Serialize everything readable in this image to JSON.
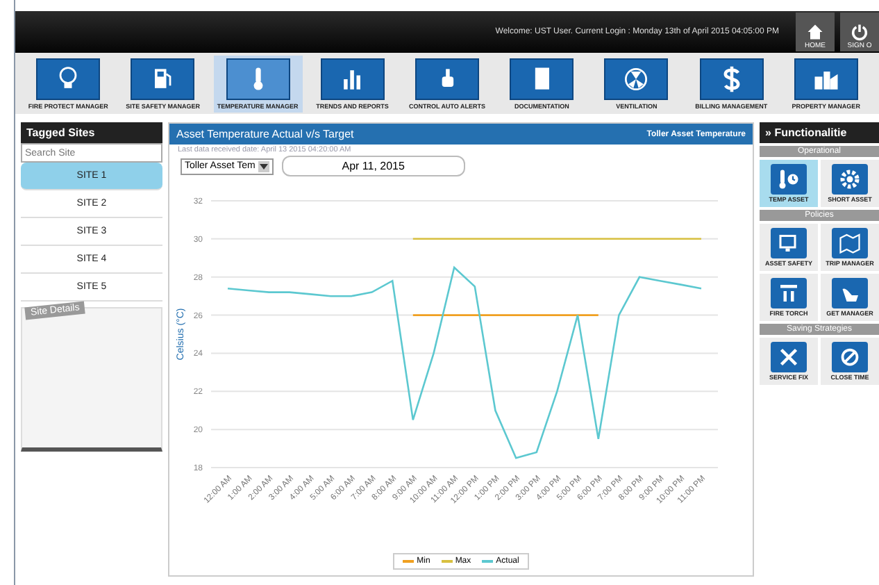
{
  "header": {
    "welcome": "Welcome: UST User. Current Login : Monday 13th of April 2015 04:05:00 PM",
    "buttons": [
      {
        "label": "HOME"
      },
      {
        "label": "SIGN O"
      }
    ]
  },
  "nav": [
    {
      "label": "FIRE PROTECT MANAGER",
      "selected": false
    },
    {
      "label": "SITE SAFETY MANAGER",
      "selected": false
    },
    {
      "label": "TEMPERATURE MANAGER",
      "selected": true
    },
    {
      "label": "TRENDS AND REPORTS",
      "selected": false
    },
    {
      "label": "CONTROL AUTO ALERTS",
      "selected": false
    },
    {
      "label": "DOCUMENTATION",
      "selected": false
    },
    {
      "label": "VENTILATION",
      "selected": false
    },
    {
      "label": "BILLING MANAGEMENT",
      "selected": false
    },
    {
      "label": "PROPERTY MANAGER",
      "selected": false
    }
  ],
  "sidebar": {
    "title": "Tagged Sites",
    "search": {
      "placeholder": "Search Site"
    },
    "sites": [
      {
        "label": "SITE 1",
        "selected": true
      },
      {
        "label": "SITE 2",
        "selected": false
      },
      {
        "label": "SITE 3",
        "selected": false
      },
      {
        "label": "SITE 4",
        "selected": false
      },
      {
        "label": "SITE 5",
        "selected": false
      }
    ],
    "details_tab": "Site Details"
  },
  "panel": {
    "title": "Asset Temperature Actual v/s Target",
    "subtitle_right": "Toller Asset Temperature",
    "last_data": "Last data received date: April 13 2015 04:20:00 AM",
    "asset_select": "Toller Asset Tem",
    "date": "Apr 11, 2015",
    "chart_data": {
      "type": "line",
      "grid": true,
      "ylabel": "Celsius (°C)",
      "categories": [
        "12:00 AM",
        "1:00 AM",
        "2:00 AM",
        "3:00 AM",
        "4:00 AM",
        "5:00 AM",
        "6:00 AM",
        "7:00 AM",
        "8:00 AM",
        "9:00 AM",
        "10:00 AM",
        "11:00 AM",
        "12:00 PM",
        "1:00 PM",
        "2:00 PM",
        "3:00 PM",
        "4:00 PM",
        "5:00 PM",
        "6:00 PM",
        "7:00 PM",
        "8:00 PM",
        "9:00 PM",
        "10:00 PM",
        "11:00 PM"
      ],
      "ylim": [
        18,
        32
      ],
      "yticks": [
        18,
        20,
        22,
        24,
        26,
        28,
        30,
        32
      ],
      "series": [
        {
          "name": "Min",
          "color": "#f0a020",
          "values": [
            null,
            null,
            null,
            null,
            null,
            null,
            null,
            null,
            null,
            26,
            26,
            26,
            26,
            26,
            26,
            26,
            26,
            26,
            26,
            null,
            null,
            null,
            null,
            null
          ]
        },
        {
          "name": "Max",
          "color": "#d8c040",
          "values": [
            null,
            null,
            null,
            null,
            null,
            null,
            null,
            null,
            null,
            30,
            30,
            30,
            30,
            30,
            30,
            30,
            30,
            30,
            30,
            30,
            30,
            30,
            30,
            30
          ]
        },
        {
          "name": "Actual",
          "color": "#5cc8d0",
          "values": [
            27.4,
            27.3,
            27.2,
            27.2,
            27.1,
            27.0,
            27.0,
            27.2,
            27.8,
            20.5,
            24.0,
            28.5,
            27.5,
            21.0,
            18.5,
            18.8,
            22.0,
            26.0,
            19.5,
            26.0,
            28.0,
            27.8,
            27.6,
            27.4
          ]
        }
      ]
    }
  },
  "functionalities": {
    "marker": "»",
    "title": "Functionalitie",
    "sections": [
      {
        "title": "Operational",
        "items": [
          {
            "label": "TEMP ASSET",
            "selected": true
          },
          {
            "label": "SHORT ASSET",
            "selected": false
          }
        ]
      },
      {
        "title": "Policies",
        "items": [
          {
            "label": "ASSET SAFETY",
            "selected": false
          },
          {
            "label": "TRIP MANAGER",
            "selected": false
          },
          {
            "label": "FIRE TORCH",
            "selected": false
          },
          {
            "label": "GET MANAGER",
            "selected": false
          }
        ]
      },
      {
        "title": "Saving Strategies",
        "items": [
          {
            "label": "SERVICE FIX",
            "selected": false
          },
          {
            "label": "CLOSE TIME",
            "selected": false
          }
        ]
      }
    ]
  }
}
